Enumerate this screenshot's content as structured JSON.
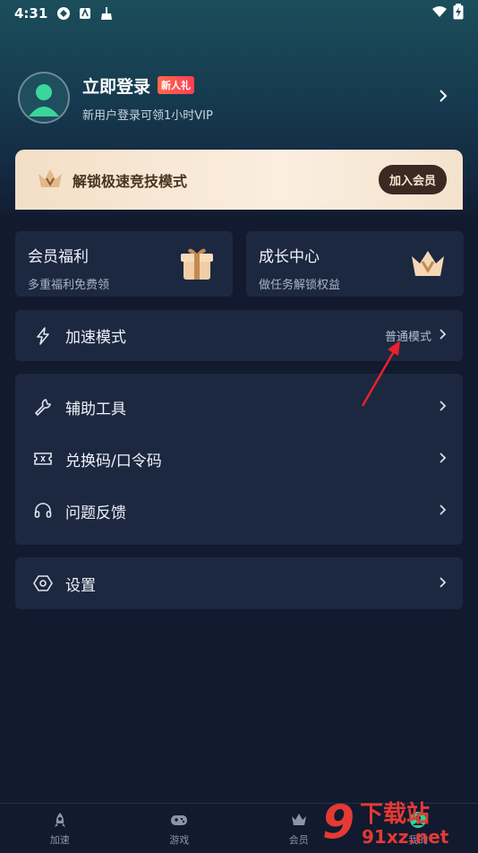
{
  "status_bar": {
    "time": "4:31"
  },
  "profile": {
    "title": "立即登录",
    "badge": "新人礼",
    "subtitle": "新用户登录可领1小时VIP"
  },
  "vip_banner": {
    "title": "解锁极速竞技模式",
    "button": "加入会员"
  },
  "cards": [
    {
      "title": "会员福利",
      "subtitle": "多重福利免费领",
      "icon": "gift-icon"
    },
    {
      "title": "成长中心",
      "subtitle": "做任务解锁权益",
      "icon": "crown-icon"
    }
  ],
  "accel": {
    "label": "加速模式",
    "value": "普通模式",
    "icon": "lightning-icon"
  },
  "menu": [
    {
      "label": "辅助工具",
      "icon": "wrench-icon"
    },
    {
      "label": "兑换码/口令码",
      "icon": "ticket-icon"
    },
    {
      "label": "问题反馈",
      "icon": "headphones-icon"
    }
  ],
  "settings": {
    "label": "设置",
    "icon": "settings-icon"
  },
  "nav": [
    {
      "label": "加速",
      "icon": "rocket-icon"
    },
    {
      "label": "游戏",
      "icon": "gamepad-icon"
    },
    {
      "label": "会员",
      "icon": "crown-icon"
    },
    {
      "label": "我的",
      "icon": "user-icon"
    }
  ],
  "watermark": {
    "number": "9",
    "site": "91xz.net",
    "cn": "下载站"
  },
  "colors": {
    "background": "#111a2e",
    "card": "#1c2840",
    "badge": "#ff4a4a",
    "vip_banner": "#f6e4cf",
    "annotation_arrow": "#e8212b"
  }
}
